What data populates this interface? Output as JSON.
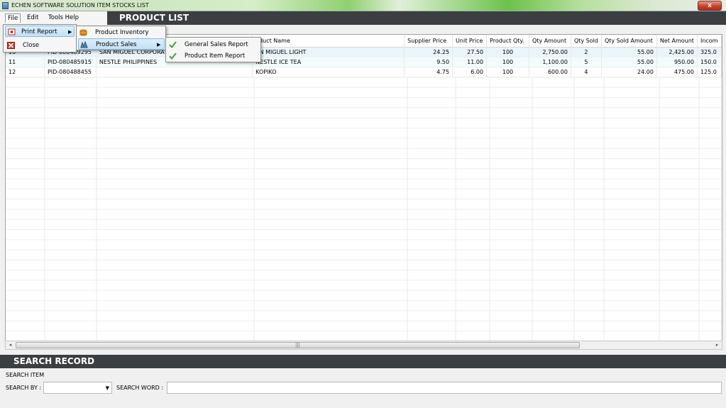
{
  "window": {
    "title": "ECHEN SOFTWARE SOLUTION ITEM STOCKS LIST",
    "close_label": "x"
  },
  "menubar": {
    "file": "File",
    "edit": "Edit",
    "tools_help": "Tools Help",
    "header_title": "PRODUCT LIST"
  },
  "file_menu": {
    "print_report": "Print Report",
    "close": "Close"
  },
  "print_report_menu": {
    "product_inventory": "Product Inventory",
    "product_sales": "Product Sales"
  },
  "product_sales_menu": {
    "general_sales_report": "General Sales Report",
    "product_item_report": "Product Item Report"
  },
  "grid": {
    "columns": [
      "",
      "",
      "",
      "oduct Name",
      "Supplier Price",
      "Unit Price",
      "Product Qty.",
      "Qty  Amount",
      "Qty Sold",
      "Qty Sold Amount",
      "Net Amount",
      "Incom"
    ],
    "rows": [
      [
        "10",
        "PID-080489295",
        "SAN MIGUEL CORPORAT",
        "AN MIGUEL LIGHT",
        "24.25",
        "27.50",
        "100",
        "2,750.00",
        "2",
        "55.00",
        "2,425.00",
        "325.0"
      ],
      [
        "11",
        "PID-080485915",
        "NESTLE PHILIPPINES",
        "NESTLE ICE TEA",
        "9.50",
        "11.00",
        "100",
        "1,100.00",
        "5",
        "55.00",
        "950.00",
        "150.0"
      ],
      [
        "12",
        "PID-080488455",
        "",
        "KOPIKO",
        "4.75",
        "6.00",
        "100",
        "600.00",
        "4",
        "24.00",
        "475.00",
        "125.0"
      ]
    ]
  },
  "scrollbar": {
    "left_arrow": "◂",
    "right_arrow": "▸",
    "thumb_grip": "|||"
  },
  "search": {
    "title": "SEARCH RECORD",
    "section_label": "SEARCH ITEM",
    "search_by_label": "SEARCH BY :",
    "search_by_value": "",
    "combo_arrow": "▼",
    "search_word_label": "SEARCH WORD :",
    "search_word_value": ""
  },
  "colors": {
    "header_bg": "#3b3f41",
    "highlight": "#c3e1f7",
    "selected_row": "#e9f5fb"
  }
}
